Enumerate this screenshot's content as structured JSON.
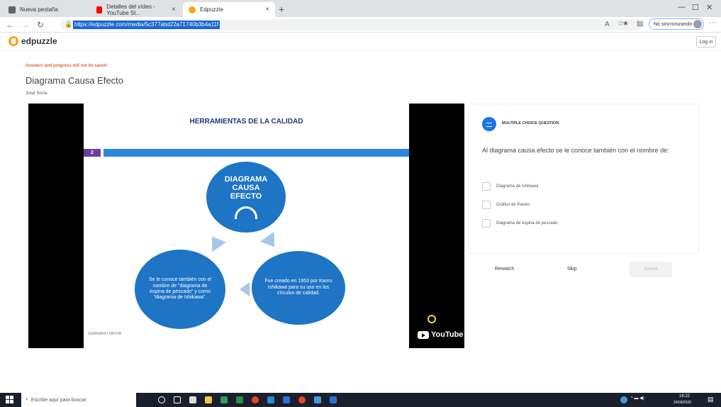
{
  "browser": {
    "tabs": [
      {
        "label": "Nueva pestaña",
        "icon": "new-tab-icon",
        "color": "#5f6368"
      },
      {
        "label": "Detalles del vídeo - YouTube St...",
        "icon": "youtube-studio-icon",
        "color": "#ff0000"
      },
      {
        "label": "Edpuzzle",
        "icon": "edpuzzle-icon",
        "color": "#f5a623"
      }
    ],
    "url": "https://edpuzzle.com/media/5c377abd22a71740b3b4a11f",
    "profile_label": "No sincronizando"
  },
  "header": {
    "logo_text": "edpuzzle",
    "login_label": "Log in"
  },
  "page": {
    "warning": "Answers and progress will not be saved",
    "title": "Diagrama Causa Efecto",
    "author": "José Soria"
  },
  "slide": {
    "title": "HERRAMIENTAS DE LA CALIDAD",
    "number": "2",
    "center": "DIAGRAMA CAUSA EFECTO",
    "left": "Se le conoce también con el nombre de \"diagrama de espina de pescado\" y como \"diagrama de Ishikawa\".",
    "right": "Fue creado en 1953 por Kaoru Ishikawa para su uso en los círculos de calidad.",
    "brand": "SEMINARIO MAYOR"
  },
  "player": {
    "logo": "YouTube"
  },
  "question": {
    "type": "MULTIPLE CHOICE QUESTION",
    "text": "Al diagrama causa efecto se le conoce también con el nombre de:",
    "options": [
      {
        "label": "Diagrama de Ishikawa"
      },
      {
        "label": "Gráfico de Pareto"
      },
      {
        "label": "Diagrama de espina de pescado"
      }
    ],
    "rewatch": "Rewatch",
    "skip": "Skip",
    "submit": "Submit"
  },
  "taskbar": {
    "search_placeholder": "Escribe aquí para buscar",
    "time": "16:22",
    "date": "24/09/2020"
  },
  "colors": {
    "accent": "#1a73e8",
    "warning": "#e0653a",
    "slide_blue": "#1e74c5"
  }
}
